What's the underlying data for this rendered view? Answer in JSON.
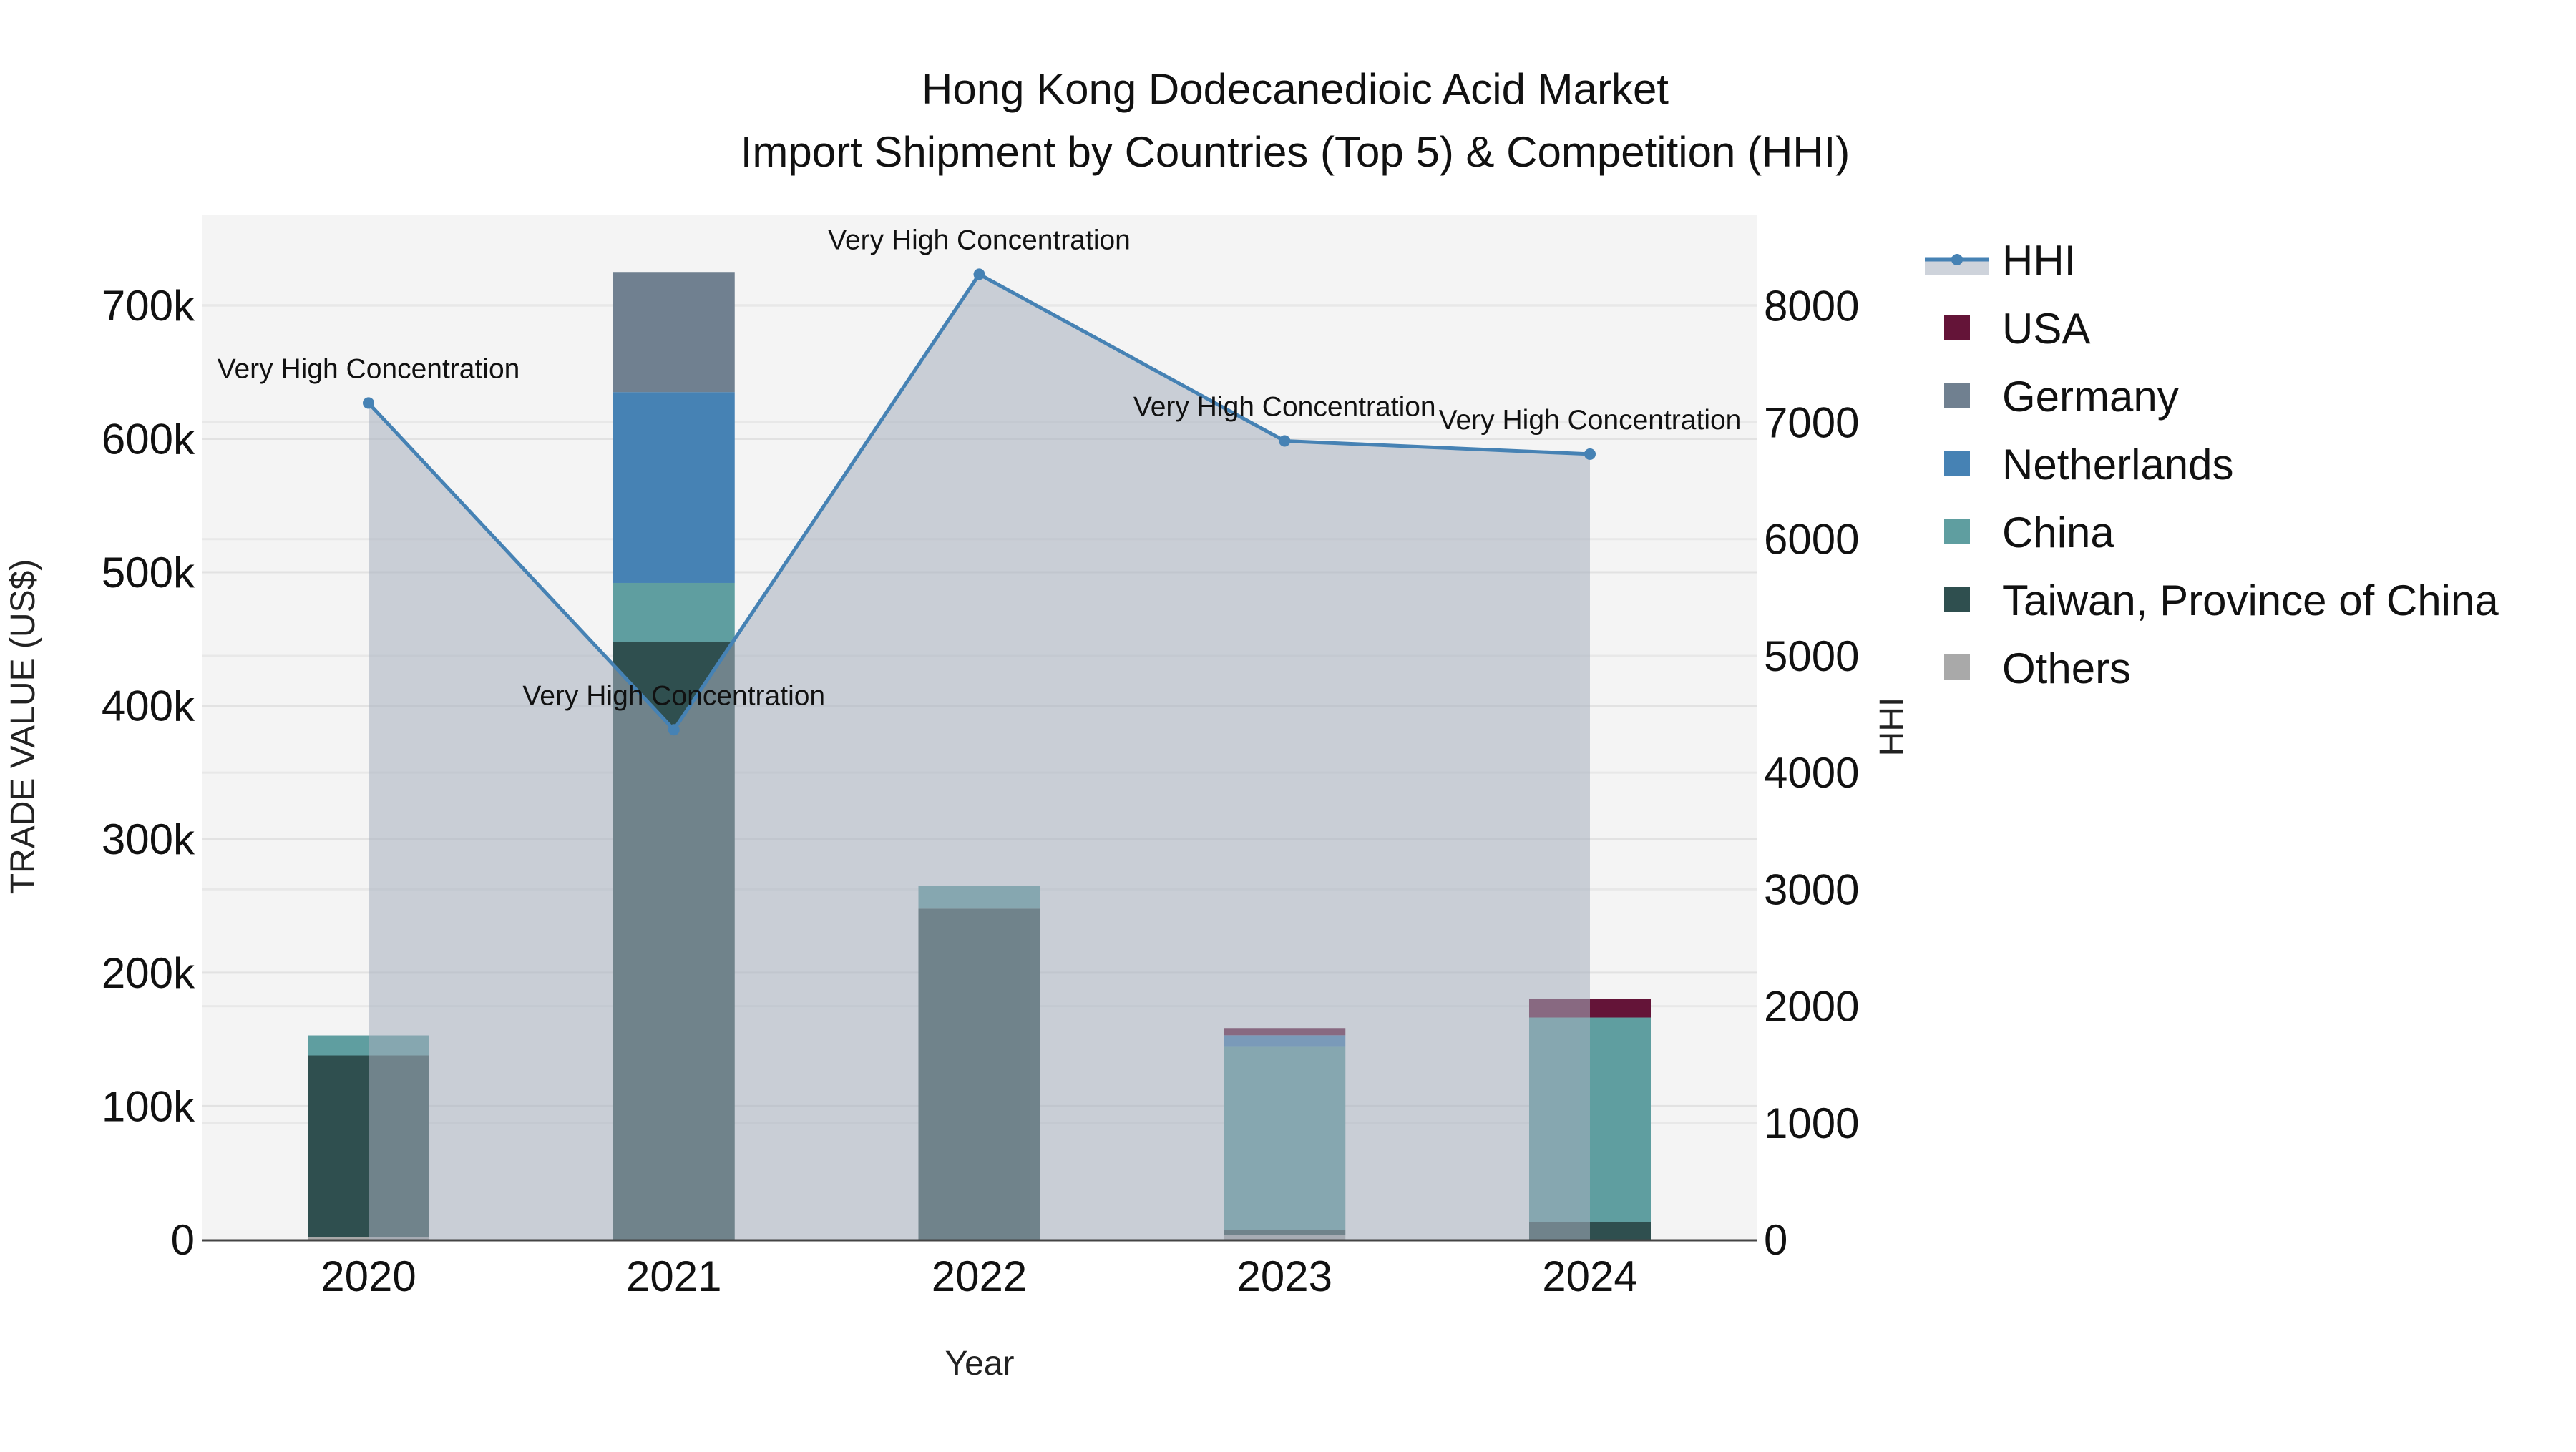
{
  "chart_data": {
    "type": "bar",
    "title": "Hong Kong Dodecanedioic Acid Market",
    "subtitle": "Import Shipment by Countries (Top 5) & Competition (HHI)",
    "xlabel": "Year",
    "ylabel": "TRADE VALUE (US$)",
    "y2label": "HHI",
    "categories": [
      "2020",
      "2021",
      "2022",
      "2023",
      "2024"
    ],
    "ylim": [
      0,
      768000
    ],
    "y2lim": [
      0,
      8780
    ],
    "yticks": [
      0,
      100000,
      200000,
      300000,
      400000,
      500000,
      600000,
      700000
    ],
    "ytick_labels": [
      "0",
      "100k",
      "200k",
      "300k",
      "400k",
      "500k",
      "600k",
      "700k"
    ],
    "y2ticks": [
      0,
      1000,
      2000,
      3000,
      4000,
      5000,
      6000,
      7000,
      8000
    ],
    "y2tick_labels": [
      "0",
      "1000",
      "2000",
      "3000",
      "4000",
      "5000",
      "6000",
      "7000",
      "8000"
    ],
    "series": [
      {
        "name": "Others",
        "color": "#a9a9a9",
        "values": [
          2000,
          0,
          0,
          3400,
          0
        ]
      },
      {
        "name": "Taiwan, Province of China",
        "color": "#2f4f4f",
        "values": [
          136000,
          448000,
          248000,
          4000,
          13400
        ]
      },
      {
        "name": "China",
        "color": "#5f9ea0",
        "values": [
          15000,
          44000,
          17000,
          137000,
          153000
        ]
      },
      {
        "name": "Netherlands",
        "color": "#4682b4",
        "values": [
          0,
          143000,
          0,
          8700,
          0
        ]
      },
      {
        "name": "Germany",
        "color": "#708090",
        "values": [
          0,
          90000,
          0,
          0,
          0
        ]
      },
      {
        "name": "USA",
        "color": "#641438",
        "values": [
          0,
          0,
          0,
          5400,
          14000
        ]
      }
    ],
    "line": {
      "name": "HHI",
      "color": "#4682b4",
      "values": [
        7166,
        4367,
        8269,
        6841,
        6728
      ],
      "annotations": [
        "Very High Concentration",
        "Very High Concentration",
        "Very High Concentration",
        "Very High Concentration",
        "Very High Concentration"
      ]
    },
    "legend_order": [
      "HHI",
      "USA",
      "Germany",
      "Netherlands",
      "China",
      "Taiwan, Province of China",
      "Others"
    ],
    "legend_placement": "right",
    "grid": true
  }
}
